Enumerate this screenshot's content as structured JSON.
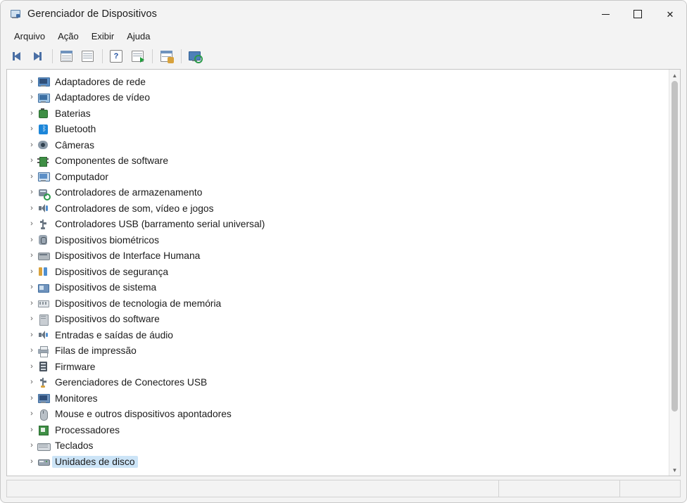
{
  "window": {
    "title": "Gerenciador de Dispositivos",
    "icon": "device-manager-icon",
    "caption": {
      "minimize": "minimize-icon",
      "maximize": "maximize-icon",
      "close": "✕"
    }
  },
  "menubar": {
    "items": [
      {
        "label": "Arquivo",
        "accel": "A"
      },
      {
        "label": "Ação",
        "accel": "ç"
      },
      {
        "label": "Exibir",
        "accel": "E"
      },
      {
        "label": "Ajuda",
        "accel": "u"
      }
    ]
  },
  "toolbar": {
    "buttons": [
      {
        "name": "back-button",
        "icon": "arrow-left-icon",
        "label": "Voltar"
      },
      {
        "name": "forward-button",
        "icon": "arrow-right-icon",
        "label": "Avançar"
      },
      {
        "name": "show-hide-console-tree-button",
        "icon": "console-tree-icon",
        "label": "Mostrar/ocultar árvore do console"
      },
      {
        "name": "properties-button",
        "icon": "properties-icon",
        "label": "Propriedades"
      },
      {
        "name": "help-button",
        "icon": "help-icon",
        "label": "Ajuda"
      },
      {
        "name": "update-driver-button",
        "icon": "update-driver-icon",
        "label": "Atualizar driver"
      },
      {
        "name": "uninstall-device-button",
        "icon": "uninstall-device-icon",
        "label": "Desinstalar dispositivo"
      },
      {
        "name": "scan-hardware-changes-button",
        "icon": "scan-hardware-icon",
        "label": "Verificar se há alterações de hardware"
      }
    ]
  },
  "tree": {
    "nodes": [
      {
        "label": "Adaptadores de rede",
        "icon": "network-adapter-icon",
        "expanded": false,
        "selected": false
      },
      {
        "label": "Adaptadores de vídeo",
        "icon": "display-adapter-icon",
        "expanded": false,
        "selected": false
      },
      {
        "label": "Baterias",
        "icon": "battery-icon",
        "expanded": false,
        "selected": false
      },
      {
        "label": "Bluetooth",
        "icon": "bluetooth-icon",
        "expanded": false,
        "selected": false
      },
      {
        "label": "Câmeras",
        "icon": "camera-icon",
        "expanded": false,
        "selected": false
      },
      {
        "label": "Componentes de software",
        "icon": "software-component-icon",
        "expanded": false,
        "selected": false
      },
      {
        "label": "Computador",
        "icon": "computer-icon",
        "expanded": false,
        "selected": false
      },
      {
        "label": "Controladores de armazenamento",
        "icon": "storage-controller-icon",
        "expanded": false,
        "selected": false
      },
      {
        "label": "Controladores de som, vídeo e jogos",
        "icon": "sound-controller-icon",
        "expanded": false,
        "selected": false
      },
      {
        "label": "Controladores USB (barramento serial universal)",
        "icon": "usb-controller-icon",
        "expanded": false,
        "selected": false
      },
      {
        "label": "Dispositivos biométricos",
        "icon": "biometric-device-icon",
        "expanded": false,
        "selected": false
      },
      {
        "label": "Dispositivos de Interface Humana",
        "icon": "hid-device-icon",
        "expanded": false,
        "selected": false
      },
      {
        "label": "Dispositivos de segurança",
        "icon": "security-device-icon",
        "expanded": false,
        "selected": false
      },
      {
        "label": "Dispositivos de sistema",
        "icon": "system-device-icon",
        "expanded": false,
        "selected": false
      },
      {
        "label": "Dispositivos de tecnologia de memória",
        "icon": "memory-technology-icon",
        "expanded": false,
        "selected": false
      },
      {
        "label": "Dispositivos do software",
        "icon": "software-device-icon",
        "expanded": false,
        "selected": false
      },
      {
        "label": "Entradas e saídas de áudio",
        "icon": "audio-io-icon",
        "expanded": false,
        "selected": false
      },
      {
        "label": "Filas de impressão",
        "icon": "print-queue-icon",
        "expanded": false,
        "selected": false
      },
      {
        "label": "Firmware",
        "icon": "firmware-icon",
        "expanded": false,
        "selected": false
      },
      {
        "label": "Gerenciadores de Conectores USB",
        "icon": "usb-connector-manager-icon",
        "expanded": false,
        "selected": false
      },
      {
        "label": "Monitores",
        "icon": "monitor-icon",
        "expanded": false,
        "selected": false
      },
      {
        "label": "Mouse e outros dispositivos apontadores",
        "icon": "mouse-icon",
        "expanded": false,
        "selected": false
      },
      {
        "label": "Processadores",
        "icon": "processor-icon",
        "expanded": false,
        "selected": false
      },
      {
        "label": "Teclados",
        "icon": "keyboard-icon",
        "expanded": false,
        "selected": false
      },
      {
        "label": "Unidades de disco",
        "icon": "disk-drive-icon",
        "expanded": false,
        "selected": true
      }
    ],
    "chevron": "›"
  },
  "statusbar": {
    "cell1": "",
    "cell2": "",
    "cell3": ""
  },
  "colors": {
    "selection": "#cce4f7",
    "window_background": "#f3f3f3",
    "content_background": "#ffffff",
    "accent_blue": "#4a6fa5"
  }
}
